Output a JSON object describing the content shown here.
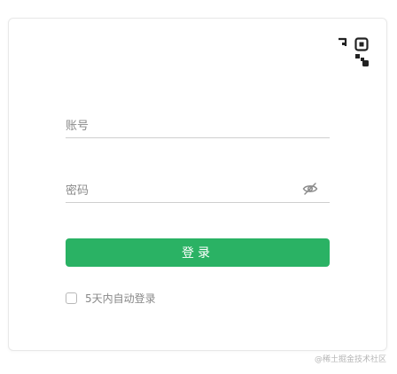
{
  "login": {
    "qr_toggle_icon": "qr-code-icon",
    "account_placeholder": "账号",
    "account_value": "",
    "password_placeholder": "密码",
    "password_value": "",
    "password_visibility_icon": "eye-off-icon",
    "submit_label": "登录",
    "remember_label": "5天内自动登录",
    "remember_checked": false
  },
  "watermark": "@稀土掘金技术社区",
  "colors": {
    "primary_button": "#2ab264",
    "field_underline": "#cfcfcf",
    "placeholder": "#8a8a8a",
    "card_border": "#e8e8e8"
  }
}
